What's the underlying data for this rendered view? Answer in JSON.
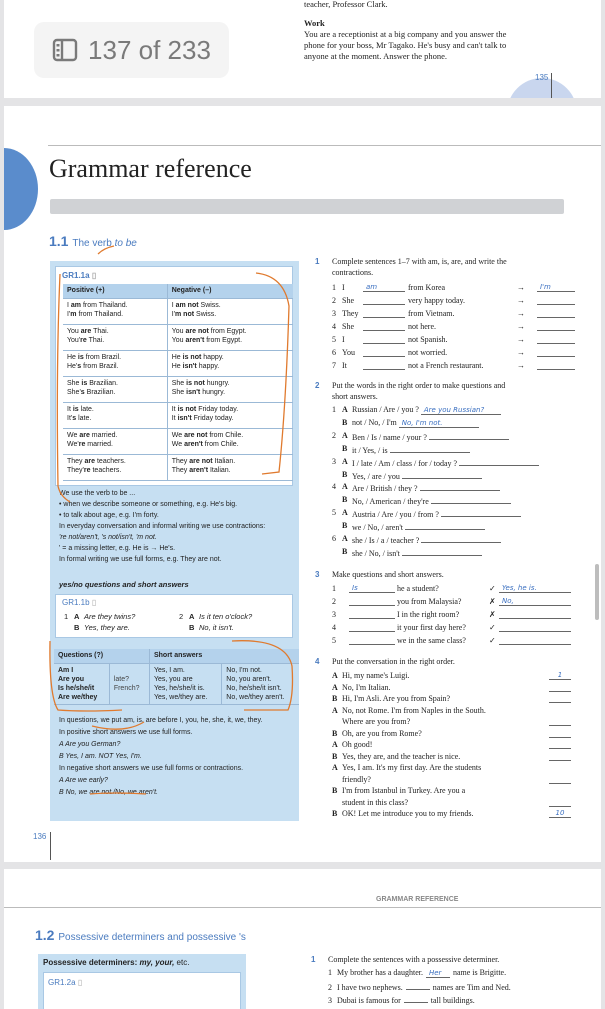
{
  "viewer": {
    "page_counter": "137 of 233",
    "icon": "sidebar-icon"
  },
  "page_135": {
    "line_top": "teacher, Professor Clark.",
    "heading": "Work",
    "paragraph": [
      "You are a receptionist at a big company and you answer the",
      "phone for your boss, Mr Tagako. He's busy and can't talk to",
      "anyone at the moment. Answer the phone."
    ],
    "page_number": "135"
  },
  "page_136": {
    "title": "Grammar reference",
    "section_number": "1.1",
    "section_title": "The verb ",
    "section_title_italic": "to be",
    "gr1a_label": "GR1.1a",
    "table_headers": [
      "Positive (+)",
      "Negative (–)"
    ],
    "table_rows": [
      [
        [
          [
            "I ",
            "am",
            " from Thailand."
          ],
          [
            "I'",
            "m",
            " from Thailand."
          ]
        ],
        [
          [
            "I ",
            "am not",
            " Swiss."
          ],
          [
            "I'",
            "m not",
            " Swiss."
          ]
        ]
      ],
      [
        [
          [
            "You ",
            "are",
            " Thai."
          ],
          [
            "You'",
            "re",
            " Thai."
          ]
        ],
        [
          [
            "You ",
            "are not",
            " from Egypt."
          ],
          [
            "You ",
            "aren't",
            " from Egypt."
          ]
        ]
      ],
      [
        [
          [
            "He ",
            "is",
            " from Brazil."
          ],
          [
            "He'",
            "s",
            " from Brazil."
          ]
        ],
        [
          [
            "He ",
            "is not",
            " happy."
          ],
          [
            "He ",
            "isn't",
            " happy."
          ]
        ]
      ],
      [
        [
          [
            "She ",
            "is",
            " Brazilian."
          ],
          [
            "She'",
            "s",
            " Brazilian."
          ]
        ],
        [
          [
            "She ",
            "is not",
            " hungry."
          ],
          [
            "She ",
            "isn't",
            " hungry."
          ]
        ]
      ],
      [
        [
          [
            "It ",
            "is",
            " late."
          ],
          [
            "It'",
            "s",
            " late."
          ]
        ],
        [
          [
            "It ",
            "is not",
            " Friday today."
          ],
          [
            "It ",
            "isn't",
            " Friday today."
          ]
        ]
      ],
      [
        [
          [
            "We ",
            "are",
            " married."
          ],
          [
            "We'",
            "re",
            " married."
          ]
        ],
        [
          [
            "We ",
            "are not",
            " from Chile."
          ],
          [
            "We ",
            "aren't",
            " from Chile."
          ]
        ]
      ],
      [
        [
          [
            "They ",
            "are",
            " teachers."
          ],
          [
            "They'",
            "re",
            " teachers."
          ]
        ],
        [
          [
            "They ",
            "are not",
            " Italian."
          ],
          [
            "They ",
            "aren't",
            " Italian."
          ]
        ]
      ]
    ],
    "notes_1": [
      "We use the verb to be ...",
      "• when we describe someone or something, e.g. He's big.",
      "• to talk about age, e.g. I'm forty.",
      "In everyday conversation and informal writing we use contractions:",
      "'re not/aren't, 's not/isn't, 'm not.",
      "' = a missing letter, e.g. He is → He's.",
      "In formal writing we use full forms, e.g. They are not."
    ],
    "yesno_heading": "yes/no questions and short answers",
    "gr1b_label": "GR1.1b",
    "gr1b_examples": [
      {
        "num": "1",
        "a": "Are they twins?",
        "b": "Yes, they are."
      },
      {
        "num": "2",
        "a": "Is it ten o'clock?",
        "b": "No, it isn't."
      }
    ],
    "q_headers": [
      "Questions (?)",
      "Short answers"
    ],
    "q_subjects": [
      "Am I",
      "Are you",
      "Is he/she/it",
      "Are we/they"
    ],
    "q_complements": [
      "late?",
      "French?"
    ],
    "q_yes": [
      "Yes, I am.",
      "Yes, you are",
      "Yes, he/she/it is.",
      "Yes, we/they are."
    ],
    "q_no": [
      "No, I'm not.",
      "No, you aren't.",
      "No, he/she/it isn't.",
      "No, we/they aren't."
    ],
    "notes_2": [
      "In questions, we put am, is, are before I, you, he, she, it, we, they.",
      "In positive short answers we use full forms.",
      "A  Are you German?",
      "B  Yes, I am. NOT Yes, I'm.",
      "In negative short answers we use full forms or contractions.",
      "A  Are we early?",
      "B  No, we are not./No, we aren't."
    ],
    "page_number": "136",
    "ex1": {
      "num": "1",
      "instruction": [
        "Complete sentences 1–7 with am, is, are, and write the",
        "contractions."
      ],
      "items": [
        {
          "n": "1",
          "pre": "I",
          "ans": "am",
          "post": "from Korea",
          "arrow_ans": "I'm"
        },
        {
          "n": "2",
          "pre": "She",
          "ans": "",
          "post": "very happy today.",
          "arrow_ans": ""
        },
        {
          "n": "3",
          "pre": "They",
          "ans": "",
          "post": "from Vietnam.",
          "arrow_ans": ""
        },
        {
          "n": "4",
          "pre": "She",
          "ans": "",
          "post": "not here.",
          "arrow_ans": ""
        },
        {
          "n": "5",
          "pre": "I",
          "ans": "",
          "post": "not Spanish.",
          "arrow_ans": ""
        },
        {
          "n": "6",
          "pre": "You",
          "ans": "",
          "post": "not worried.",
          "arrow_ans": ""
        },
        {
          "n": "7",
          "pre": "It",
          "ans": "",
          "post": "not a French restaurant.",
          "arrow_ans": ""
        }
      ]
    },
    "ex2": {
      "num": "2",
      "instruction": [
        "Put the words in the right order to make questions and",
        "short answers."
      ],
      "items": [
        {
          "n": "1",
          "l": "A",
          "text": "Russian / Are / you ?",
          "ans": "Are you Russian?"
        },
        {
          "n": "",
          "l": "B",
          "text": "not / No, / I'm",
          "ans": "No, I'm not."
        },
        {
          "n": "2",
          "l": "A",
          "text": "Ben / Is / name / your ?",
          "ans": ""
        },
        {
          "n": "",
          "l": "B",
          "text": "it / Yes, / is",
          "ans": ""
        },
        {
          "n": "3",
          "l": "A",
          "text": "I / late / Am / class / for / today ?",
          "ans": ""
        },
        {
          "n": "",
          "l": "B",
          "text": "Yes, / are / you",
          "ans": ""
        },
        {
          "n": "4",
          "l": "A",
          "text": "Are / British / they ?",
          "ans": ""
        },
        {
          "n": "",
          "l": "B",
          "text": "No, / American / they're",
          "ans": ""
        },
        {
          "n": "5",
          "l": "A",
          "text": "Austria / Are / you / from ?",
          "ans": ""
        },
        {
          "n": "",
          "l": "B",
          "text": "we / No, / aren't",
          "ans": ""
        },
        {
          "n": "6",
          "l": "A",
          "text": "she / Is / a / teacher ?",
          "ans": ""
        },
        {
          "n": "",
          "l": "B",
          "text": "she / No, / isn't",
          "ans": ""
        }
      ]
    },
    "ex3": {
      "num": "3",
      "instruction": "Make questions and short answers.",
      "items": [
        {
          "n": "1",
          "ans": "Is",
          "text": "he a student?",
          "mark": "✓",
          "ans2": "Yes, he is."
        },
        {
          "n": "2",
          "ans": "",
          "text": "you from Malaysia?",
          "mark": "✗",
          "ans2": "No,"
        },
        {
          "n": "3",
          "ans": "",
          "text": "I in the right room?",
          "mark": "✗",
          "ans2": ""
        },
        {
          "n": "4",
          "ans": "",
          "text": "it your first day here?",
          "mark": "✓",
          "ans2": ""
        },
        {
          "n": "5",
          "ans": "",
          "text": "we in the same class?",
          "mark": "✓",
          "ans2": ""
        }
      ]
    },
    "ex4": {
      "num": "4",
      "instruction": "Put the conversation in the right order.",
      "items": [
        {
          "l": "A",
          "text": "Hi, my name's Luigi.",
          "ans": "1"
        },
        {
          "l": "A",
          "text": "No, I'm Italian.",
          "ans": ""
        },
        {
          "l": "B",
          "text": "Hi, I'm Asli. Are you from Spain?",
          "ans": ""
        },
        {
          "l": "A",
          "text": "No, not Rome. I'm from Naples in the South.",
          "ans": null
        },
        {
          "l": "",
          "text": "Where are you from?",
          "ans": ""
        },
        {
          "l": "B",
          "text": "Oh, are you from Rome?",
          "ans": ""
        },
        {
          "l": "A",
          "text": "Oh good!",
          "ans": ""
        },
        {
          "l": "B",
          "text": "Yes, they are, and the teacher is nice.",
          "ans": ""
        },
        {
          "l": "A",
          "text": "Yes, I am. It's my first day. Are the students",
          "ans": null
        },
        {
          "l": "",
          "text": "friendly?",
          "ans": ""
        },
        {
          "l": "B",
          "text": "I'm from Istanbul in Turkey. Are you a",
          "ans": null
        },
        {
          "l": "",
          "text": "student in this class?",
          "ans": ""
        },
        {
          "l": "B",
          "text": "OK! Let me introduce you to my friends.",
          "ans": "10"
        }
      ]
    }
  },
  "page_137": {
    "running_header": "GRAMMAR REFERENCE",
    "section_number": "1.2",
    "section_title": "Possessive determiners and possessive 's",
    "box_heading": "Possessive determiners: ",
    "box_heading_italic": "my, your,",
    "box_heading_end": " etc.",
    "gr2a_label": "GR1.2a",
    "ex1": {
      "num": "1",
      "instruction": "Complete the sentences with a possessive determiner.",
      "items": [
        {
          "n": "1",
          "pre": "My brother has a daughter.",
          "ans": "Her",
          "post": "name is Brigitte."
        },
        {
          "n": "2",
          "pre": "I have two nephews.",
          "ans": "",
          "post": "names are Tim and Ned."
        },
        {
          "n": "3",
          "pre": "Dubai is famous for",
          "ans": "",
          "post": "tall buildings."
        }
      ]
    }
  },
  "colors": {
    "accent_blue": "#4a7bbf",
    "box_blue": "#c6dff2",
    "header_blue": "#b4d2ec",
    "annotation_orange": "#e07a2e",
    "handwriting_blue": "#3a6fc0"
  }
}
